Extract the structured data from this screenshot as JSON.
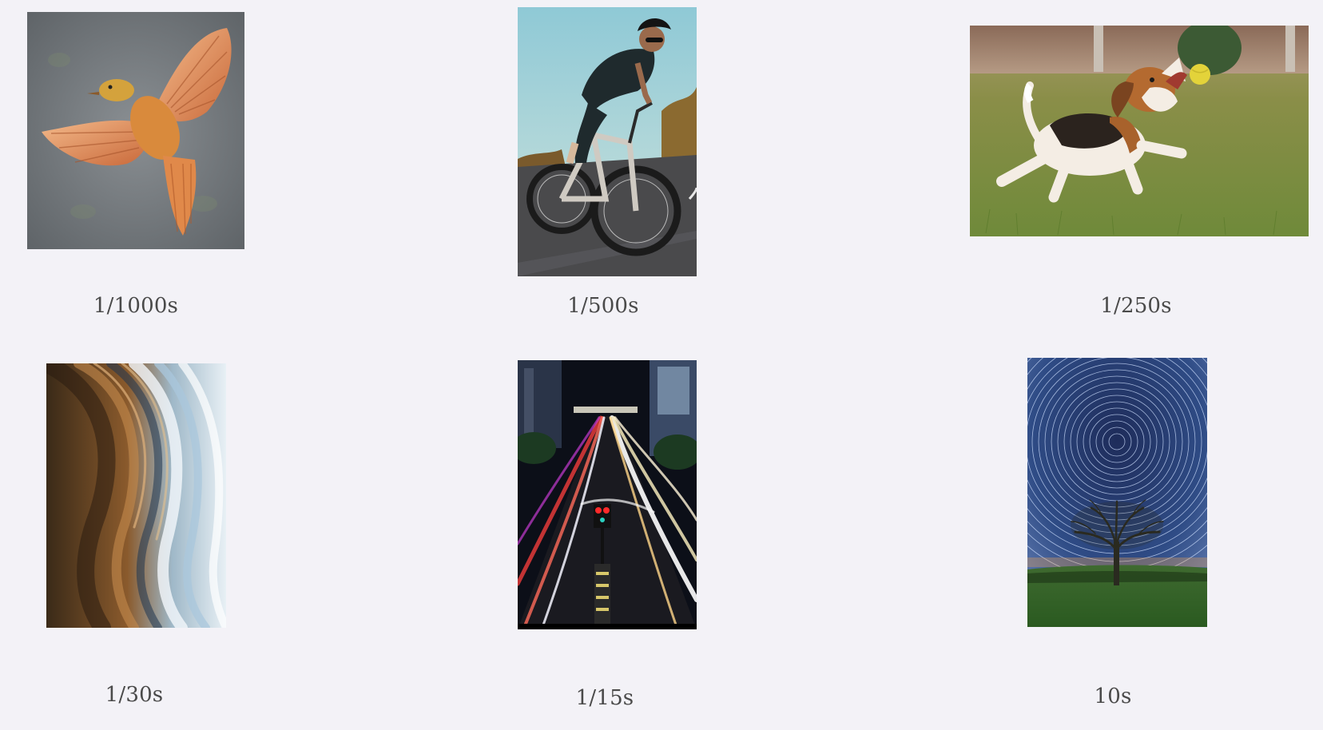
{
  "gallery": {
    "items": [
      {
        "subject": "bird in flight",
        "shutter_speed": "1/1000s"
      },
      {
        "subject": "road cyclist",
        "shutter_speed": "1/500s"
      },
      {
        "subject": "beagle chasing ball",
        "shutter_speed": "1/250s"
      },
      {
        "subject": "blurred waterfall",
        "shutter_speed": "1/30s"
      },
      {
        "subject": "city light trails",
        "shutter_speed": "1/15s"
      },
      {
        "subject": "star trails over tree",
        "shutter_speed": "10s"
      }
    ]
  },
  "colors": {
    "background": "#f3f2f7",
    "caption_text": "#4a4a4a"
  }
}
